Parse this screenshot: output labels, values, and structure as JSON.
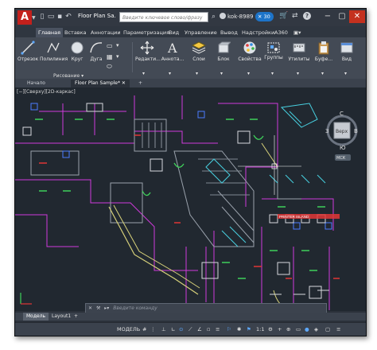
{
  "app": {
    "logo_letter": "A",
    "document_title": "Floor Plan Sa...",
    "search_placeholder": "Введите ключевое слово/фразу",
    "user_name": "kok-8989",
    "notifications_count": "30",
    "help_label": "?"
  },
  "ribbon_tabs": [
    {
      "label": "Главная",
      "active": true
    },
    {
      "label": "Вставка"
    },
    {
      "label": "Аннотации"
    },
    {
      "label": "Параметризация"
    },
    {
      "label": "Вид"
    },
    {
      "label": "Управление"
    },
    {
      "label": "Вывод"
    },
    {
      "label": "Надстройки"
    },
    {
      "label": "A360"
    }
  ],
  "ribbon": {
    "draw_tools": [
      "Отрезок",
      "Полилиния",
      "Круг",
      "Дуга"
    ],
    "draw_panel_label": "Рисование",
    "modify_label": "Редакти...",
    "annotation_label": "Аннота...",
    "layers_label": "Слои",
    "block_label": "Блок",
    "properties_label": "Свойства",
    "groups_label": "Группы",
    "utilities_label": "Утилиты",
    "clipboard_label": "Буфе...",
    "view_label": "Вид"
  },
  "file_tabs": [
    {
      "label": "Начало"
    },
    {
      "label": "Floor Plan Sample*",
      "active": true
    },
    {
      "label": "+"
    }
  ],
  "viewport": {
    "label": "[−][Сверху][2D-каркас]",
    "viewcube_top": "Верх",
    "compass": {
      "n": "С",
      "s": "Ю",
      "w": "З",
      "e": "В"
    },
    "ucs_label": "МСК",
    "room_tag": "PRINTER ISLAND"
  },
  "command_line": {
    "placeholder": "Введите команду"
  },
  "layout_tabs": [
    {
      "label": "Модель",
      "active": true
    },
    {
      "label": "Layout1"
    },
    {
      "label": "+"
    }
  ],
  "status_bar": {
    "model_label": "МОДЕЛЬ",
    "scale_label": "1:1",
    "plus_label": "+"
  },
  "colors": {
    "accent_red": "#c4201c",
    "canvas": "#212830",
    "badge_blue": "#1d74c9"
  }
}
